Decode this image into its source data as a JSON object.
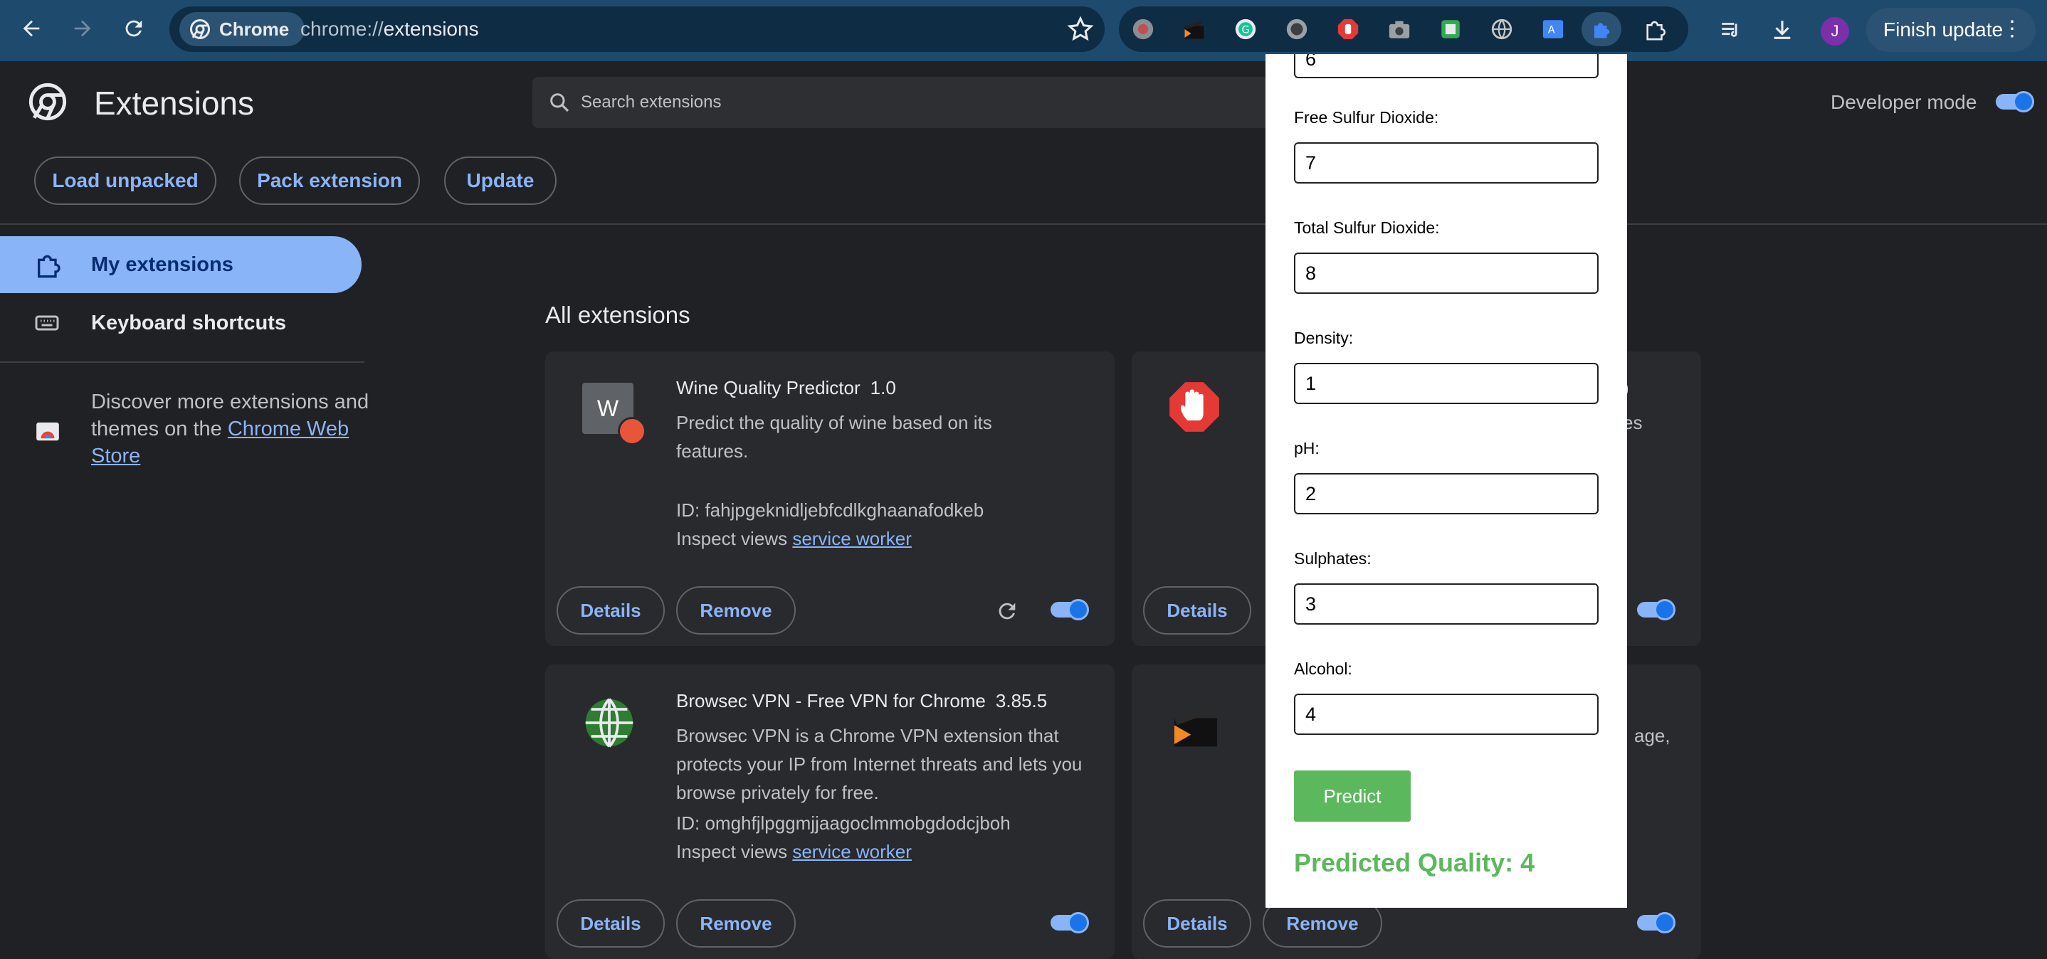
{
  "browser": {
    "chip_label": "Chrome",
    "url_scheme": "chrome://",
    "url_path": "extensions",
    "profile_initial": "J",
    "finish_update_label": "Finish update"
  },
  "header": {
    "title": "Extensions",
    "search_placeholder": "Search extensions",
    "developer_mode_label": "Developer mode",
    "developer_mode_on": true
  },
  "toolbar": {
    "load_unpacked": "Load unpacked",
    "pack_extension": "Pack extension",
    "update": "Update"
  },
  "sidebar": {
    "items": [
      {
        "label": "My extensions",
        "active": true
      },
      {
        "label": "Keyboard shortcuts",
        "active": false
      }
    ],
    "discover_text": "Discover more extensions and themes on the ",
    "discover_link": "Chrome Web Store"
  },
  "main": {
    "section_title": "All extensions",
    "cards": [
      {
        "name": "Wine Quality Predictor",
        "version": "1.0",
        "description": "Predict the quality of wine based on its features.",
        "id_text": "ID: fahjpgeknidljebfcdlkghaanafodkeb",
        "inspect_label": "Inspect views",
        "inspect_link": "service worker",
        "details": "Details",
        "remove": "Remove",
        "enabled": true
      },
      {
        "name_fragment": ")",
        "description_fragment": "es",
        "details": "Details",
        "enabled": true
      },
      {
        "name": "Browsec VPN - Free VPN for Chrome",
        "version": "3.85.5",
        "description": "Browsec VPN is a Chrome VPN extension that protects your IP from Internet threats and lets you browse privately for free.",
        "id_text": "ID: omghfjlpggmjjaagoclmmobgdodcjboh",
        "inspect_label": "Inspect views",
        "inspect_link": "service worker",
        "details": "Details",
        "remove": "Remove",
        "enabled": true
      },
      {
        "description_fragment": "age,",
        "details": "Details",
        "remove": "Remove",
        "enabled": true
      }
    ]
  },
  "popup": {
    "top_value": "6",
    "fields": [
      {
        "label": "Free Sulfur Dioxide:",
        "value": "7"
      },
      {
        "label": "Total Sulfur Dioxide:",
        "value": "8"
      },
      {
        "label": "Density:",
        "value": "1"
      },
      {
        "label": "pH:",
        "value": "2"
      },
      {
        "label": "Sulphates:",
        "value": "3"
      },
      {
        "label": "Alcohol:",
        "value": "4"
      }
    ],
    "predict_label": "Predict",
    "result": "Predicted Quality: 4"
  },
  "colors": {
    "topbar": "#1e4a6e",
    "page_bg": "#202124",
    "card_bg": "#292a2d",
    "accent_blue": "#8ab4f8",
    "predict_green": "#5cb85c"
  }
}
